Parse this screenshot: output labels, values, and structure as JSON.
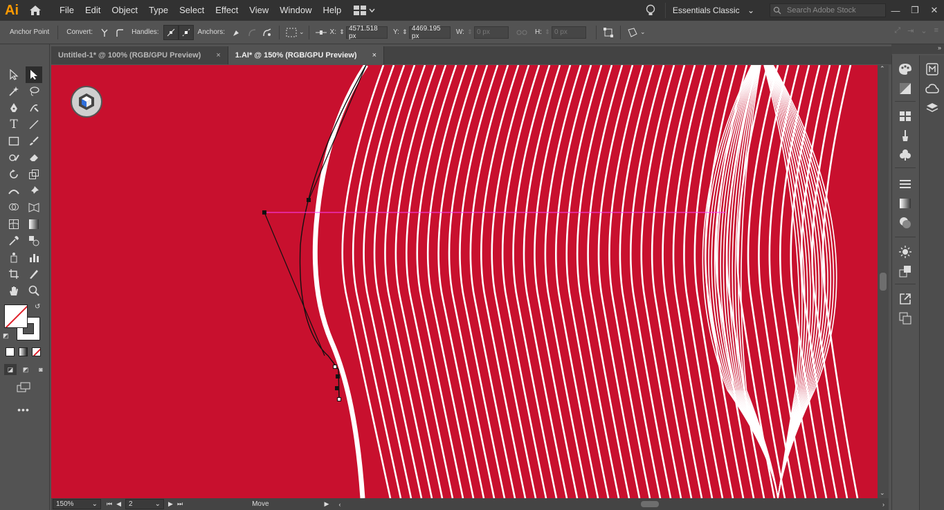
{
  "app": {
    "logo": "Ai"
  },
  "menu": {
    "items": [
      "File",
      "Edit",
      "Object",
      "Type",
      "Select",
      "Effect",
      "View",
      "Window",
      "Help"
    ]
  },
  "workspace": {
    "label": "Essentials Classic"
  },
  "stock_search": {
    "placeholder": "Search Adobe Stock"
  },
  "control": {
    "anchor_point": "Anchor Point",
    "convert": "Convert:",
    "handles": "Handles:",
    "anchors": "Anchors:",
    "x_label": "X:",
    "x_value": "4571.518 px",
    "y_label": "Y:",
    "y_value": "4469.195 px",
    "w_label": "W:",
    "w_value": "0 px",
    "h_label": "H:",
    "h_value": "0 px"
  },
  "tabs": [
    {
      "label": "Untitled-1* @ 100% (RGB/GPU Preview)",
      "close": "×"
    },
    {
      "label": "1.AI* @ 150% (RGB/GPU Preview)",
      "close": "×"
    }
  ],
  "status": {
    "zoom": "150%",
    "page": "2",
    "tool": "Move"
  },
  "icons": {
    "home": "home-icon",
    "lightbulb": "lightbulb-icon",
    "search": "search-icon",
    "selection": "selection-tool-icon",
    "direct_selection": "direct-selection-tool-icon",
    "pen": "pen-tool-icon",
    "type": "type-tool-icon",
    "hand": "hand-tool-icon",
    "zoom": "zoom-tool-icon"
  },
  "colors": {
    "canvas": "#c8102e",
    "ui_dark": "#323232",
    "ui_mid": "#535353",
    "accent_orange": "#ff9a00",
    "guide_magenta": "#ff3cff"
  }
}
